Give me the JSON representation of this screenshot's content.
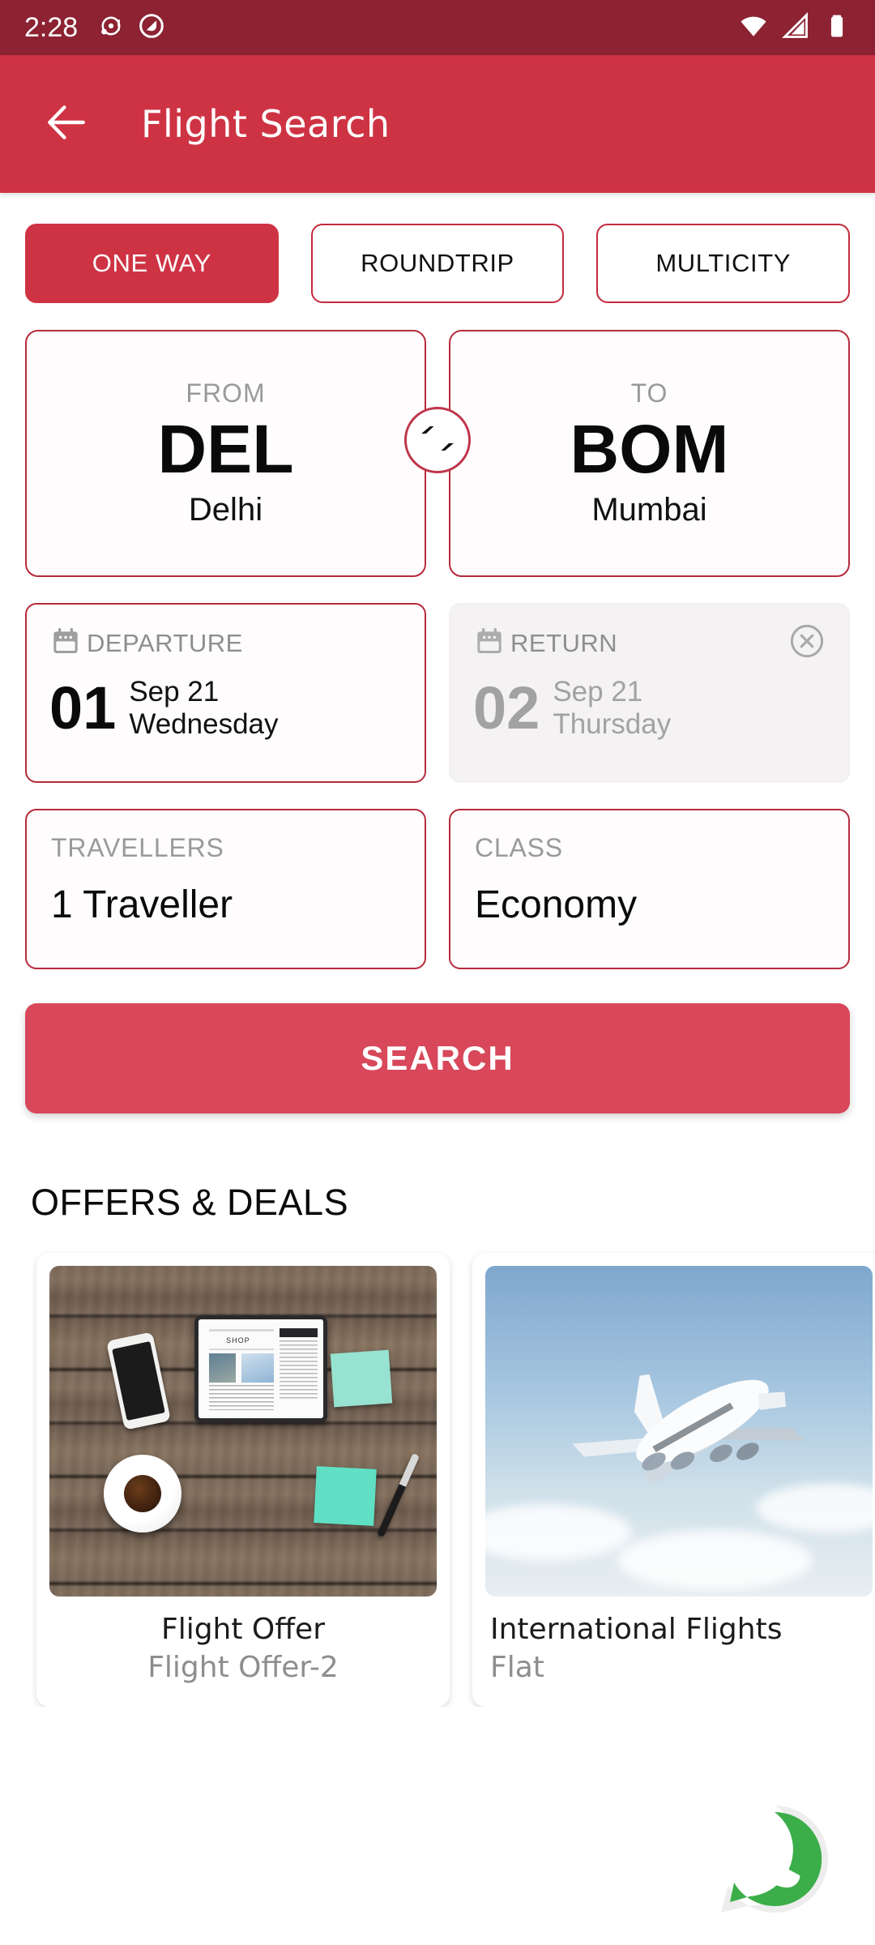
{
  "status_bar": {
    "time": "2:28",
    "left_icons": [
      "notification-dots-icon",
      "do-not-disturb-icon"
    ],
    "right_icons": [
      "wifi-icon",
      "signal-icon",
      "battery-icon"
    ],
    "background": "#8C2232"
  },
  "app_bar": {
    "back_icon": "back-arrow-icon",
    "title": "Flight Search",
    "background": "#CE3344"
  },
  "trip_tabs": [
    {
      "label": "ONE WAY",
      "active": true
    },
    {
      "label": "ROUNDTRIP",
      "active": false
    },
    {
      "label": "MULTICITY",
      "active": false
    }
  ],
  "route": {
    "from": {
      "label": "FROM",
      "code": "DEL",
      "city": "Delhi"
    },
    "to": {
      "label": "TO",
      "code": "BOM",
      "city": "Mumbai"
    },
    "swap_icon": "swap-horizontal-icon"
  },
  "dates": {
    "departure": {
      "icon": "calendar-icon",
      "label": "DEPARTURE",
      "day": "01",
      "month_year": "Sep 21",
      "weekday": "Wednesday",
      "enabled": true
    },
    "return": {
      "icon": "calendar-icon",
      "label": "RETURN",
      "day": "02",
      "month_year": "Sep 21",
      "weekday": "Thursday",
      "enabled": false,
      "clear_icon": "close-circle-icon"
    }
  },
  "travellers": {
    "label": "TRAVELLERS",
    "value": "1 Traveller"
  },
  "travel_class": {
    "label": "CLASS",
    "value": "Economy"
  },
  "search_button": {
    "label": "SEARCH",
    "color": "#D8475A"
  },
  "offers_section": {
    "title": "OFFERS & DEALS",
    "cards": [
      {
        "title": "Flight Offer",
        "subtitle": "Flight Offer-2",
        "image": "desk-flatlay-photo"
      },
      {
        "title": "International Flights",
        "subtitle": "Flat",
        "image": "airplane-photo"
      }
    ]
  },
  "floating_action": {
    "icon": "whatsapp-icon",
    "color": "#25D366"
  },
  "colors": {
    "brand_red": "#CE3344",
    "brand_red_dark": "#8C2232",
    "border_red": "#B62B3C",
    "muted_grey": "#9A9A9A",
    "disabled_bg": "#F4F2F2",
    "whatsapp_green": "#2EAC4F"
  }
}
